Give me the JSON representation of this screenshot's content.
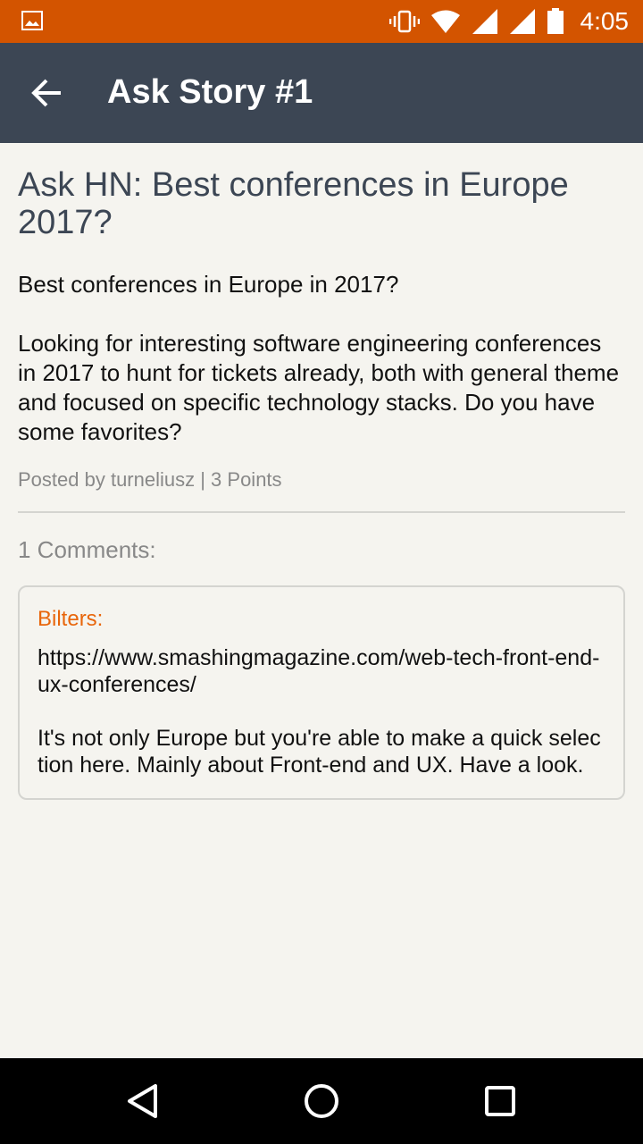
{
  "status_bar": {
    "time": "4:05",
    "icons": [
      "image-icon",
      "vibrate-icon",
      "wifi-icon",
      "signal-icon",
      "signal-icon",
      "battery-icon"
    ]
  },
  "app_bar": {
    "title": "Ask Story #1",
    "back_icon": "arrow-back-icon"
  },
  "story": {
    "title": "Ask HN: Best conferences in Europe 2017?",
    "body": "Best conferences in Europe in 2017?\n\nLooking for interesting software engineering conferences in 2017 to hunt for tickets already, both with general theme and focused on specific technology stacks. Do you have some favorites?",
    "meta": "Posted by turneliusz | 3 Points"
  },
  "comments": {
    "heading": "1 Comments:",
    "items": [
      {
        "author": "Bilters:",
        "text": "https://www.smashingmagazine.com/web-tech-front-end-ux-conferences/\n\nIt's not only Europe but you're able to make a quick selection here. Mainly about Front-end and UX. Have a look."
      }
    ]
  },
  "nav_bar": {
    "icons": [
      "back-triangle-icon",
      "home-circle-icon",
      "recents-square-icon"
    ]
  },
  "colors": {
    "status_bar": "#d35400",
    "app_bar": "#3c4654",
    "background": "#f5f4ef",
    "author_accent": "#e8650a"
  }
}
